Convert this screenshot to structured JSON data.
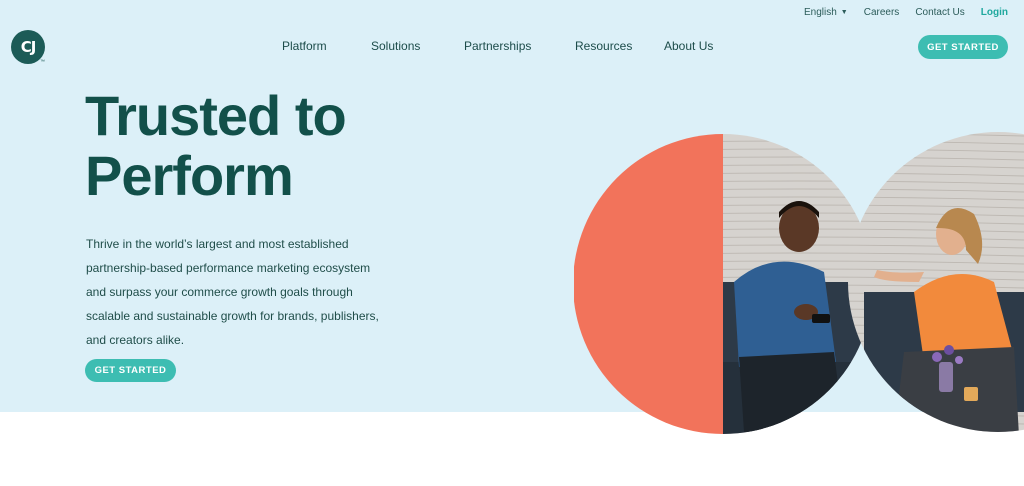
{
  "utility_nav": {
    "language": "English",
    "careers": "Careers",
    "contact": "Contact Us",
    "login": "Login"
  },
  "logo": {
    "mark": "CJ",
    "tm": "™"
  },
  "main_nav": [
    {
      "label": "Platform"
    },
    {
      "label": "Solutions"
    },
    {
      "label": "Partnerships"
    },
    {
      "label": "Resources"
    },
    {
      "label": "About Us"
    }
  ],
  "header_cta": "GET STARTED",
  "hero": {
    "headline_line1": "Trusted to",
    "headline_line2": "Perform",
    "body_lines": [
      "Thrive in the world’s largest and most established",
      "partnership-based performance marketing ecosystem",
      "and surpass your commerce growth goals through",
      "scalable and sustainable growth for brands, publishers,",
      "and creators alike."
    ],
    "cta": "GET STARTED"
  },
  "colors": {
    "hero_bg": "#dcf0f8",
    "brand_dark": "#12504a",
    "accent_teal": "#3dbdb2",
    "coral": "#f2735b",
    "login": "#1fa89e"
  }
}
